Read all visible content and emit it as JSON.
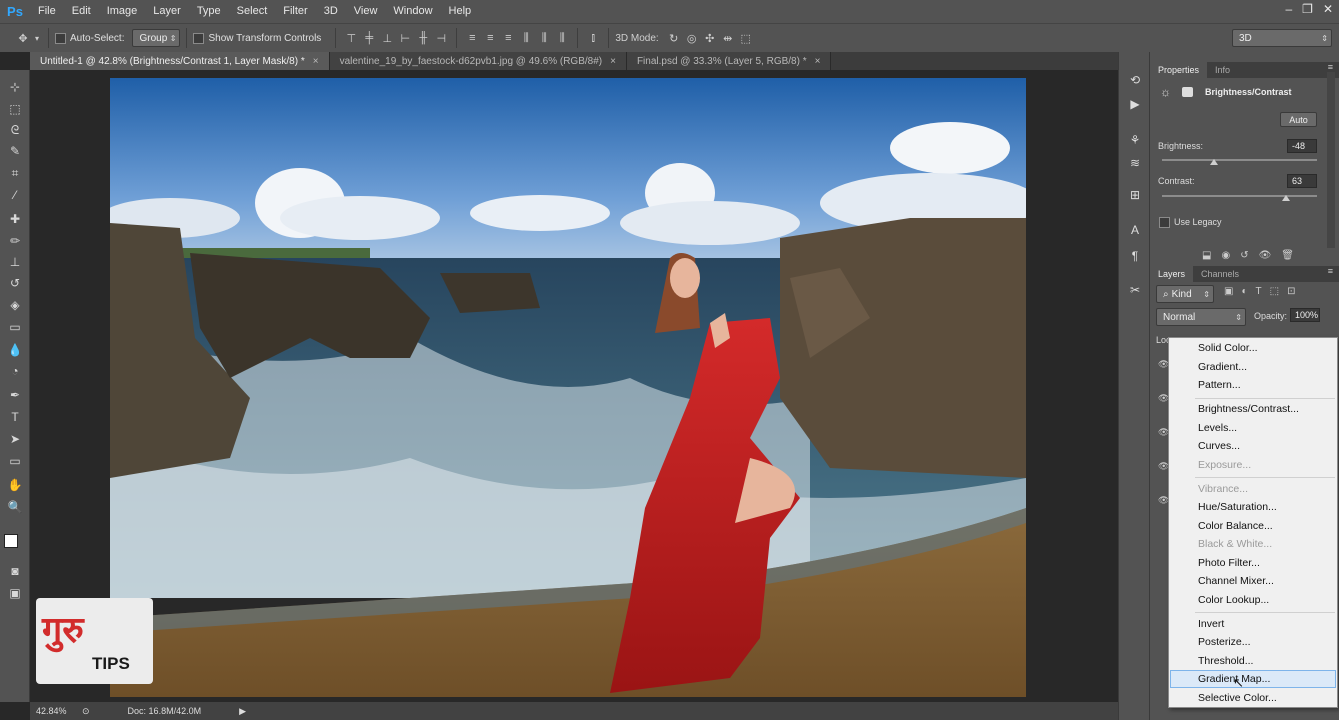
{
  "app": {
    "logo": "Ps"
  },
  "menu": [
    "File",
    "Edit",
    "Image",
    "Layer",
    "Type",
    "Select",
    "Filter",
    "3D",
    "View",
    "Window",
    "Help"
  ],
  "options": {
    "auto_select_label": "Auto-Select:",
    "auto_select_value": "Group",
    "show_transform_label": "Show Transform Controls",
    "mode_3d_label": "3D Mode:",
    "workspace_value": "3D"
  },
  "tabs": [
    {
      "label": "Untitled-1 @ 42.8% (Brightness/Contrast 1, Layer Mask/8) *",
      "close": "×"
    },
    {
      "label": "valentine_19_by_faestock-d62pvb1.jpg @ 49.6% (RGB/8#)",
      "close": "×"
    },
    {
      "label": "Final.psd @ 33.3% (Layer 5, RGB/8) *",
      "close": "×"
    }
  ],
  "status": {
    "zoom": "42.84%",
    "doc": "Doc: 16.8M/42.0M"
  },
  "properties": {
    "tabs": [
      "Properties",
      "Info"
    ],
    "title": "Brightness/Contrast",
    "auto_label": "Auto",
    "brightness_label": "Brightness:",
    "brightness_value": "-48",
    "contrast_label": "Contrast:",
    "contrast_value": "63",
    "use_legacy_label": "Use Legacy"
  },
  "layers": {
    "tabs": [
      "Layers",
      "Channels"
    ],
    "kind_value": "Kind",
    "blend_value": "Normal",
    "opacity_label": "Opacity:",
    "opacity_value": "100%",
    "lock_label": "Loc"
  },
  "adjustment_menu": {
    "groups": [
      [
        "Solid Color...",
        "Gradient...",
        "Pattern..."
      ],
      [
        "Brightness/Contrast...",
        "Levels...",
        "Curves...",
        "Exposure..."
      ],
      [
        "Vibrance...",
        "Hue/Saturation...",
        "Color Balance...",
        "Black & White...",
        "Photo Filter...",
        "Channel Mixer...",
        "Color Lookup..."
      ],
      [
        "Invert",
        "Posterize...",
        "Threshold...",
        "Gradient Map...",
        "Selective Color..."
      ]
    ],
    "disabled": [
      "Exposure...",
      "Vibrance...",
      "Black & White..."
    ],
    "hovered": "Gradient Map..."
  },
  "watermark": {
    "line1": "गुरु",
    "line2": "TIPS"
  },
  "colors": {
    "accent": "#31a8ff",
    "panel": "#535353",
    "dark": "#282828"
  }
}
